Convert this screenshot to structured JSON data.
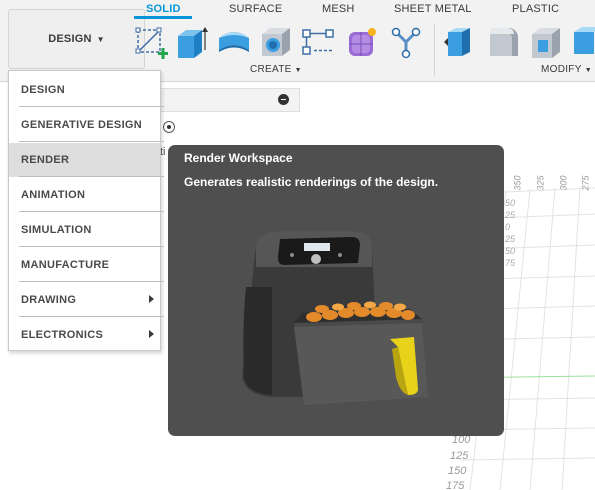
{
  "toolbar": {
    "workspace_button": "DESIGN",
    "tabs": [
      {
        "label": "SOLID",
        "active": true
      },
      {
        "label": "SURFACE",
        "active": false
      },
      {
        "label": "MESH",
        "active": false
      },
      {
        "label": "SHEET METAL",
        "active": false
      },
      {
        "label": "PLASTIC",
        "active": false
      }
    ],
    "groups": {
      "create": "CREATE",
      "modify": "MODIFY"
    },
    "create_tools": [
      "create-sketch-icon",
      "extrude-icon",
      "revolve-icon",
      "hole-icon",
      "pattern-icon",
      "form-icon",
      "joint-icon"
    ],
    "modify_tools": [
      "press-pull-icon",
      "fillet-icon",
      "shell-icon",
      "combine-icon"
    ]
  },
  "workspace_menu": {
    "items": [
      {
        "label": "DESIGN",
        "highlighted": false,
        "submenu": false
      },
      {
        "label": "GENERATIVE DESIGN",
        "highlighted": false,
        "submenu": false
      },
      {
        "label": "RENDER",
        "highlighted": true,
        "submenu": false
      },
      {
        "label": "ANIMATION",
        "highlighted": false,
        "submenu": false
      },
      {
        "label": "SIMULATION",
        "highlighted": false,
        "submenu": false
      },
      {
        "label": "MANUFACTURE",
        "highlighted": false,
        "submenu": false
      },
      {
        "label": "DRAWING",
        "highlighted": false,
        "submenu": true
      },
      {
        "label": "ELECTRONICS",
        "highlighted": false,
        "submenu": true
      }
    ]
  },
  "tooltip": {
    "title": "Render Workspace",
    "description": "Generates realistic renderings of the design.",
    "image": "air-fryer-render"
  },
  "canvas": {
    "grid_labels_top": [
      "350",
      "325",
      "300",
      "275"
    ],
    "grid_labels_left": [
      "50",
      "25",
      "0",
      "25",
      "50",
      "75"
    ],
    "grid_labels_bottom": [
      "100",
      "125",
      "150",
      "175"
    ],
    "partial_text": "ti"
  },
  "colors": {
    "accent": "#0696d7",
    "tooltip_bg": "#4f4f4f",
    "menu_highlight": "#dedede"
  }
}
